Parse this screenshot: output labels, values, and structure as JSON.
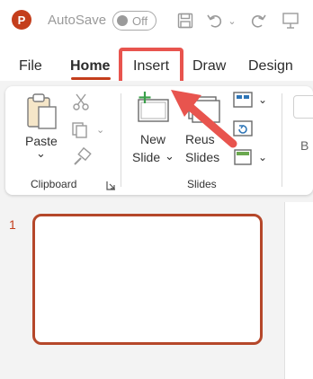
{
  "titlebar": {
    "app_logo_letter": "P",
    "autosave_label": "AutoSave",
    "autosave_state": "Off",
    "icons": [
      "save-icon",
      "undo-icon",
      "redo-icon",
      "present-icon"
    ]
  },
  "tabs": [
    {
      "label": "File",
      "active": false
    },
    {
      "label": "Home",
      "active": true
    },
    {
      "label": "Insert",
      "active": false,
      "highlighted": true
    },
    {
      "label": "Draw",
      "active": false
    },
    {
      "label": "Design",
      "active": false
    }
  ],
  "ribbon": {
    "clipboard": {
      "paste_label": "Paste",
      "paste_chevron": "⌄",
      "group_label": "Clipboard"
    },
    "slides": {
      "new_slide_line1": "New",
      "new_slide_line2": "Slide",
      "new_slide_chevron": "⌄",
      "reuse_line1": "Reus",
      "reuse_line2": "Slides",
      "group_label": "Slides"
    },
    "font_partial": "B"
  },
  "slide_panel": {
    "slide_number": "1"
  },
  "colors": {
    "accent": "#c43e1c",
    "highlight": "#e8544e",
    "ribbon_bg": "#f3f3f3"
  }
}
